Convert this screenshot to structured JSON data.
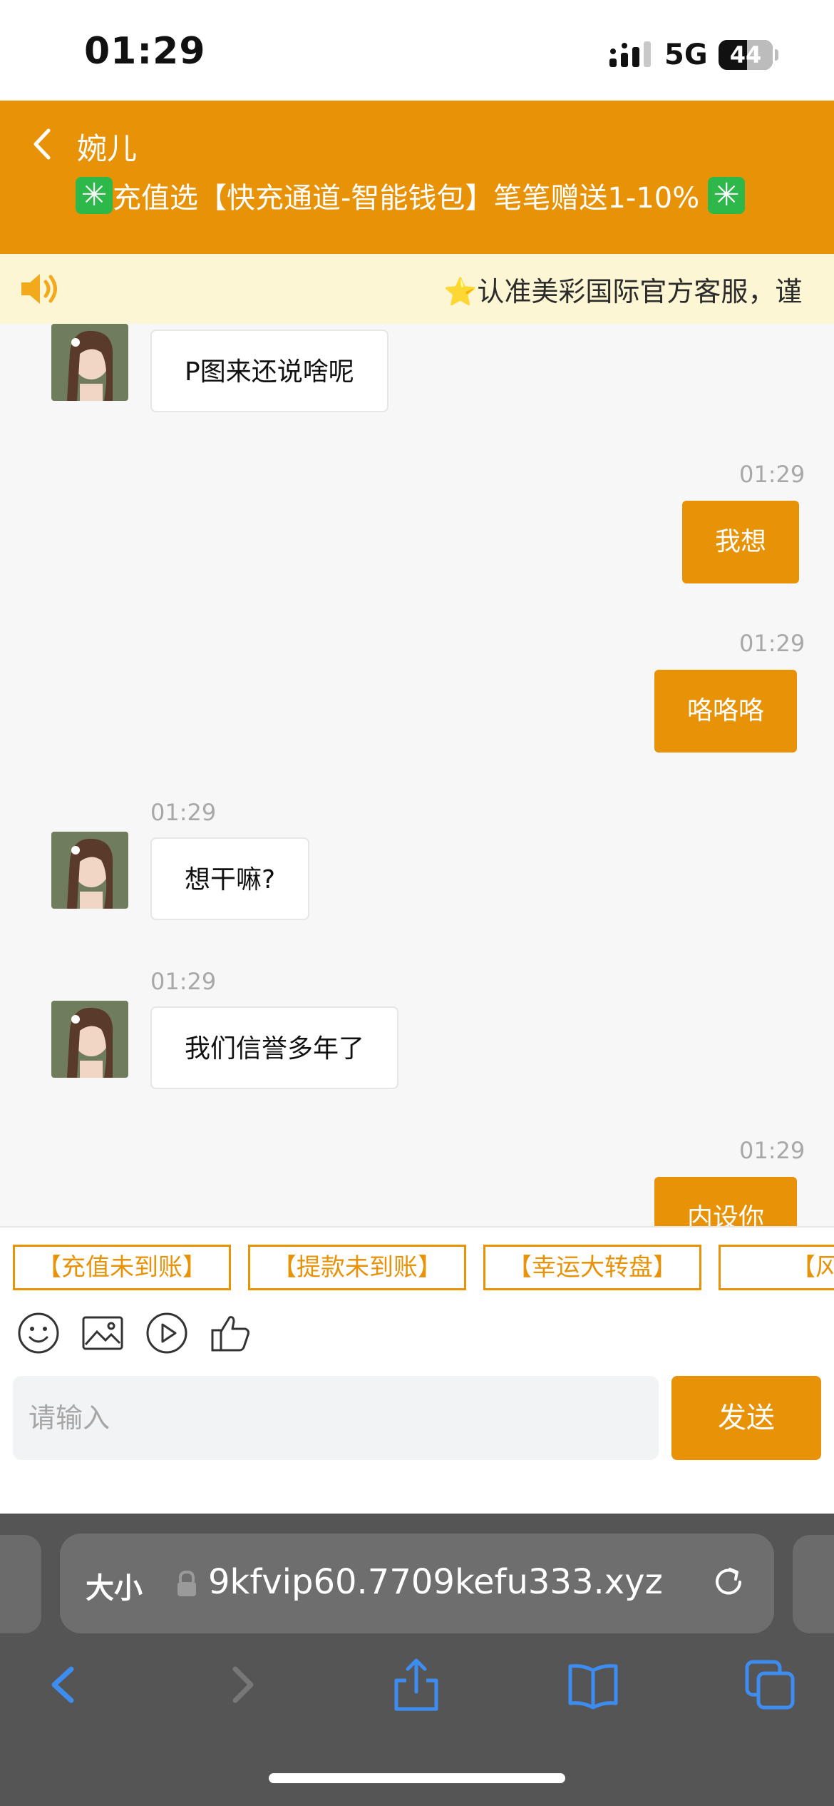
{
  "status": {
    "time": "01:29",
    "network": "5G",
    "battery": "44"
  },
  "header": {
    "contact_name": "婉儿",
    "promo": "充值选【快充通道-智能钱包】笔笔赠送1-10%"
  },
  "notice": {
    "text": "⭐认准美彩国际官方客服，谨"
  },
  "messages": [
    {
      "from": "agent",
      "time": "",
      "text": "P图来还说啥呢"
    },
    {
      "from": "user",
      "time": "01:29",
      "text": "我想"
    },
    {
      "from": "user",
      "time": "01:29",
      "text": "咯咯咯"
    },
    {
      "from": "agent",
      "time": "01:29",
      "text": "想干嘛?"
    },
    {
      "from": "agent",
      "time": "01:29",
      "text": "我们信誉多年了"
    },
    {
      "from": "user",
      "time": "01:29",
      "text": "内设你"
    }
  ],
  "quick_replies": [
    "【充值未到账】",
    "【提款未到账】",
    "【幸运大转盘】",
    "【风暴"
  ],
  "tools": [
    "emoji-icon",
    "image-icon",
    "video-icon",
    "thumbs-up-icon"
  ],
  "input": {
    "placeholder": "请输入",
    "value": ""
  },
  "send_label": "发送",
  "browser": {
    "text_size_label": "大小",
    "url": "9kfvip60.7709kefu333.xyz"
  },
  "colors": {
    "accent": "#e89207",
    "notice_bg": "#fdf6d4",
    "safari_bg": "#555555"
  }
}
